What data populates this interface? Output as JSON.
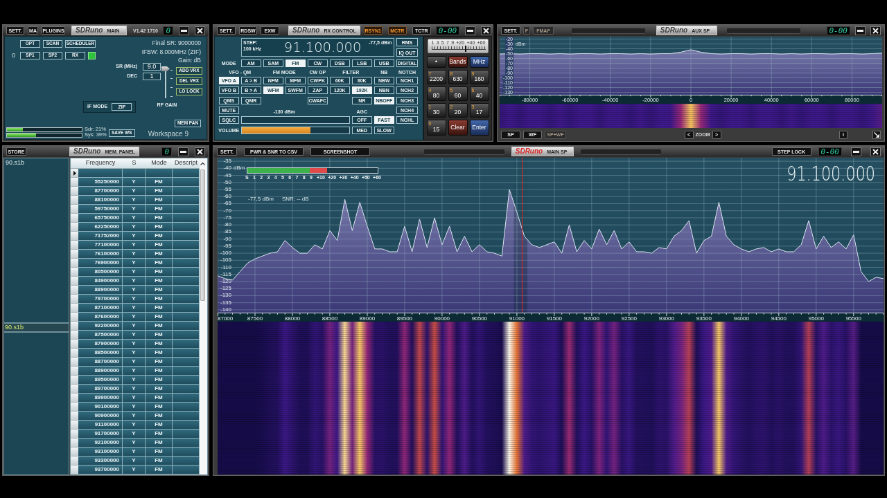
{
  "main_panel": {
    "title_bar": {
      "buttons": [
        "SETT.",
        "MA",
        "PLUGINS"
      ],
      "logo": "SDRuno",
      "title": "MAIN",
      "active": false,
      "version": "V1.42 1710",
      "counter": "0"
    },
    "top_buttons": [
      "OPT",
      "SCAN",
      "SCHEDULER"
    ],
    "rx_number": "0",
    "rx_buttons": [
      "SP1",
      "SP2",
      "RX"
    ],
    "rx_indicator": {
      "on": true
    },
    "info": [
      "Final SR: 9000000",
      "IFBW: 8.000MHz (ZIF)",
      "Gain: dB"
    ],
    "fields": [
      {
        "label": "SR (MHz)",
        "value": "9.0"
      },
      {
        "label": "DEC",
        "value": "1"
      }
    ],
    "rf_gain": {
      "label": "RF GAIN",
      "level": 1
    },
    "vrx_buttons": [
      "ADD VRX",
      "DEL VRX",
      "LO LOCK"
    ],
    "if_mode": {
      "label": "IF MODE",
      "value": "ZIF"
    },
    "mem_pan_button": "MEM PAN",
    "cpu_meters": [
      {
        "reading": "Sdr: 21%",
        "level": 0.21
      },
      {
        "reading": "Sys: 39%",
        "level": 0.39
      }
    ],
    "save_button": "SAVE WS",
    "workspace": "Workspace 9"
  },
  "rx_control": {
    "title_bar": {
      "left_buttons": [
        "SETT.",
        "RDSW",
        "EXW"
      ],
      "logo": "SDRuno",
      "title": "RX CONTROL",
      "active": false,
      "toggles": [
        {
          "label": "RSYN1",
          "on": true
        },
        {
          "label": "MCTR",
          "on": true
        },
        {
          "label": "TCTR",
          "on": false
        }
      ],
      "counter": "0-00"
    },
    "display": {
      "step_label": "STEP:",
      "step": "100 kHz",
      "frequency": "91.100.000",
      "signal": "-77,5 dBm"
    },
    "display_buttons": [
      "RMS",
      "IQ OUT"
    ],
    "mode": {
      "label": "MODE",
      "options": [
        {
          "label": "AM",
          "selected": false
        },
        {
          "label": "SAM",
          "selected": false
        },
        {
          "label": "FM",
          "selected": true
        },
        {
          "label": "CW",
          "selected": false
        },
        {
          "label": "DSB",
          "selected": false
        },
        {
          "label": "LSB",
          "selected": false
        },
        {
          "label": "USB",
          "selected": false
        },
        {
          "label": "DIGITAL",
          "selected": false
        }
      ]
    },
    "groups": [
      {
        "label": "VFO - QM",
        "buttons": [
          {
            "label": "VFO A",
            "selected": true
          },
          {
            "label": "A > B",
            "selected": false
          },
          {
            "label": "VFO B",
            "selected": false
          },
          {
            "label": "B > A",
            "selected": false
          },
          {
            "label": "QMS",
            "selected": false
          },
          {
            "label": "QMR",
            "selected": false
          }
        ]
      },
      {
        "label": "FM MODE",
        "buttons": [
          {
            "label": "NFM",
            "selected": false
          },
          {
            "label": "MFM",
            "selected": false
          },
          {
            "label": "WFM",
            "selected": true
          },
          {
            "label": "SWFM",
            "selected": false
          }
        ]
      },
      {
        "label": "CW OP",
        "buttons": [
          {
            "label": "CWPK",
            "selected": false
          },
          {
            "label": "ZAP",
            "selected": false
          },
          {
            "label": "CWAFC",
            "selected": false
          }
        ]
      },
      {
        "label": "FILTER",
        "buttons": [
          {
            "label": "60K",
            "selected": false
          },
          {
            "label": "80K",
            "selected": false
          },
          {
            "label": "120K",
            "selected": false
          },
          {
            "label": "192K",
            "selected": true
          },
          {
            "label": "NR",
            "selected": false
          }
        ]
      },
      {
        "label": "NB",
        "buttons": [
          {
            "label": "NBW",
            "selected": false
          },
          {
            "label": "NBN",
            "selected": false
          },
          {
            "label": "NBOFF",
            "selected": true
          }
        ]
      },
      {
        "label": "NOTCH",
        "buttons": [
          {
            "label": "NCH1",
            "selected": false
          },
          {
            "label": "NCH2",
            "selected": false
          },
          {
            "label": "NCH3",
            "selected": false
          },
          {
            "label": "NCH4",
            "selected": false
          },
          {
            "label": "NCHL",
            "selected": false
          }
        ]
      }
    ],
    "mute_button": "MUTE",
    "squelch_button": "SQLC",
    "squelch": {
      "reading": "-130 dBm"
    },
    "agc": {
      "label": "AGC",
      "options": [
        {
          "label": "OFF",
          "selected": false
        },
        {
          "label": "FAST",
          "selected": true
        },
        {
          "label": "MED",
          "selected": false
        },
        {
          "label": "SLOW",
          "selected": false
        }
      ]
    },
    "volume": {
      "label": "VOLUME",
      "level": 0.64
    },
    "keypad": {
      "meter": {
        "scale": [
          "1",
          "3",
          "5",
          "7",
          "9",
          "+20",
          "+40",
          "+60"
        ],
        "level": 0.62
      },
      "keys": [
        {
          "kind": "dark",
          "label": "•"
        },
        {
          "kind": "red",
          "label": "Bands"
        },
        {
          "kind": "blue",
          "label": "MHz"
        },
        {
          "kind": "dark",
          "digit": "7",
          "label": "2200"
        },
        {
          "kind": "dark",
          "digit": "8",
          "label": "630"
        },
        {
          "kind": "dark",
          "digit": "9",
          "label": "160"
        },
        {
          "kind": "dark",
          "digit": "4",
          "label": "80"
        },
        {
          "kind": "dark",
          "digit": "5",
          "label": "60"
        },
        {
          "kind": "dark",
          "digit": "6",
          "label": "40"
        },
        {
          "kind": "dark",
          "digit": "1",
          "label": "30"
        },
        {
          "kind": "dark",
          "digit": "2",
          "label": "20"
        },
        {
          "kind": "dark",
          "digit": "3",
          "label": "17"
        },
        {
          "kind": "dark",
          "digit": "0",
          "label": "15"
        },
        {
          "kind": "red",
          "label": "Clear"
        },
        {
          "kind": "blue",
          "label": "Enter"
        }
      ]
    }
  },
  "aux_spectrum": {
    "title_bar": {
      "left_buttons": [
        {
          "label": "SETT.",
          "disabled": false
        },
        {
          "label": "F",
          "disabled": true
        },
        {
          "label": "FMAF",
          "disabled": true
        }
      ],
      "logo": "SDRuno",
      "title": "AUX SP",
      "active": false,
      "counter": "0-00"
    },
    "chart_data": {
      "type": "area",
      "ylabel": "dBm",
      "x": [
        -95000,
        -90000,
        -85000,
        -80000,
        -75000,
        -70000,
        -65000,
        -60000,
        -55000,
        -50000,
        -45000,
        -40000,
        -35000,
        -30000,
        -25000,
        -20000,
        -15000,
        -10000,
        -5000,
        0,
        5000,
        10000,
        15000,
        20000,
        25000,
        30000,
        35000,
        40000,
        45000,
        50000,
        55000,
        60000,
        65000,
        70000,
        75000,
        80000,
        85000,
        90000,
        95000
      ],
      "series": [
        {
          "values": [
            -51,
            -50,
            -51,
            -50,
            -50,
            -51,
            -50,
            -51,
            -50,
            -50,
            -51,
            -50,
            -50,
            -51,
            -50,
            -51,
            -50,
            -50,
            -47,
            -42,
            -47,
            -50,
            -51,
            -50,
            -50,
            -51,
            -50,
            -50,
            -51,
            -50,
            -51,
            -50,
            -50,
            -51,
            -50,
            -50,
            -51,
            -50,
            -49
          ]
        }
      ],
      "xlim": [
        -95000,
        95000
      ],
      "ylim": [
        -135,
        -15
      ],
      "xticks": [
        -80000,
        -60000,
        -40000,
        -20000,
        0,
        20000,
        40000,
        60000,
        80000
      ],
      "yticks": [
        -20,
        -30,
        -40,
        -50,
        -60,
        -70,
        -80,
        -90,
        -100,
        -110,
        -120,
        -130
      ],
      "grid": true
    },
    "view_buttons": [
      {
        "label": "SP",
        "selected": false
      },
      {
        "label": "WF",
        "selected": false
      },
      {
        "label": "SP+WF",
        "selected": true
      }
    ],
    "zoom": {
      "label": "ZOOM",
      "previous": "<",
      "next": ">"
    },
    "info_button": "i"
  },
  "memory_panel": {
    "title_bar": {
      "buttons": [
        "STORE"
      ],
      "logo": "SDRuno",
      "title": "MEM. PANEL",
      "active": false,
      "counter": "0"
    },
    "bank_list": [
      {
        "name": "90.s1b",
        "selected": false
      }
    ],
    "file_field": {
      "value": "90.s1b"
    },
    "table": {
      "columns": [
        "Frequency",
        "S",
        "Mode",
        "Descript"
      ],
      "rows": [
        {
          "current": true
        },
        {
          "frequency": "55250000",
          "s": "Y",
          "mode": "FM",
          "current": false
        },
        {
          "frequency": "87700000",
          "s": "Y",
          "mode": "FM",
          "current": false
        },
        {
          "frequency": "88100000",
          "s": "Y",
          "mode": "FM",
          "current": false
        },
        {
          "frequency": "59750000",
          "s": "Y",
          "mode": "FM",
          "current": false
        },
        {
          "frequency": "65750000",
          "s": "Y",
          "mode": "FM",
          "current": false
        },
        {
          "frequency": "62250000",
          "s": "Y",
          "mode": "FM",
          "current": false
        },
        {
          "frequency": "71752000",
          "s": "Y",
          "mode": "FM",
          "current": false
        },
        {
          "frequency": "77100000",
          "s": "Y",
          "mode": "FM",
          "current": false
        },
        {
          "frequency": "76100000",
          "s": "Y",
          "mode": "FM",
          "current": false
        },
        {
          "frequency": "76900000",
          "s": "Y",
          "mode": "FM",
          "current": false
        },
        {
          "frequency": "80500000",
          "s": "Y",
          "mode": "FM",
          "current": false
        },
        {
          "frequency": "84900000",
          "s": "Y",
          "mode": "FM",
          "current": false
        },
        {
          "frequency": "88900000",
          "s": "Y",
          "mode": "FM",
          "current": false
        },
        {
          "frequency": "79700000",
          "s": "Y",
          "mode": "FM",
          "current": false
        },
        {
          "frequency": "87100000",
          "s": "Y",
          "mode": "FM",
          "current": false
        },
        {
          "frequency": "87600000",
          "s": "Y",
          "mode": "FM",
          "current": false
        },
        {
          "frequency": "92200000",
          "s": "Y",
          "mode": "FM",
          "current": false
        },
        {
          "frequency": "87500000",
          "s": "Y",
          "mode": "FM",
          "current": false
        },
        {
          "frequency": "87900000",
          "s": "Y",
          "mode": "FM",
          "current": false
        },
        {
          "frequency": "88500000",
          "s": "Y",
          "mode": "FM",
          "current": false
        },
        {
          "frequency": "88700000",
          "s": "Y",
          "mode": "FM",
          "current": false
        },
        {
          "frequency": "88900000",
          "s": "Y",
          "mode": "FM",
          "current": false
        },
        {
          "frequency": "89500000",
          "s": "Y",
          "mode": "FM",
          "current": false
        },
        {
          "frequency": "89700000",
          "s": "Y",
          "mode": "FM",
          "current": false
        },
        {
          "frequency": "89900000",
          "s": "Y",
          "mode": "FM",
          "current": false
        },
        {
          "frequency": "90100000",
          "s": "Y",
          "mode": "FM",
          "current": false
        },
        {
          "frequency": "90900000",
          "s": "Y",
          "mode": "FM",
          "current": false
        },
        {
          "frequency": "91100000",
          "s": "Y",
          "mode": "FM",
          "current": false
        },
        {
          "frequency": "91700000",
          "s": "Y",
          "mode": "FM",
          "current": false
        },
        {
          "frequency": "92100000",
          "s": "Y",
          "mode": "FM",
          "current": false
        },
        {
          "frequency": "93100000",
          "s": "Y",
          "mode": "FM",
          "current": false
        },
        {
          "frequency": "93300000",
          "s": "Y",
          "mode": "FM",
          "current": false
        },
        {
          "frequency": "93700000",
          "s": "Y",
          "mode": "FM",
          "current": false
        }
      ]
    }
  },
  "main_spectrum": {
    "title_bar": {
      "left_buttons": [
        "SETT.",
        "PWR & SNR TO CSV",
        "SCREENSHOT"
      ],
      "logo": "SDRuno",
      "title": "MAIN SP",
      "active": true,
      "right_button": "STEP LOCK",
      "counter": "0-00"
    },
    "s_meter": {
      "scale": [
        "S",
        "1",
        "2",
        "3",
        "4",
        "5",
        "6",
        "7",
        "8",
        "9",
        "+10",
        "+20",
        "+30",
        "+40",
        "+50",
        "+60"
      ],
      "level": 0.61
    },
    "readout": "-77,5 dBm",
    "snr": "SNR: -- dB",
    "frequency": "91.100.000",
    "chart_data": {
      "type": "area",
      "ylabel": "dBm",
      "x": [
        87000,
        87100,
        87200,
        87300,
        87400,
        87500,
        87600,
        87700,
        87800,
        87900,
        88000,
        88100,
        88200,
        88300,
        88400,
        88500,
        88600,
        88700,
        88800,
        88900,
        89000,
        89100,
        89200,
        89300,
        89400,
        89500,
        89600,
        89700,
        89800,
        89900,
        90000,
        90100,
        90200,
        90300,
        90400,
        90500,
        90600,
        90700,
        90800,
        90900,
        91000,
        91100,
        91200,
        91300,
        91400,
        91500,
        91600,
        91700,
        91800,
        91900,
        92000,
        92100,
        92200,
        92300,
        92400,
        92500,
        92600,
        92700,
        92800,
        92900,
        93000,
        93100,
        93200,
        93300,
        93400,
        93500,
        93600,
        93700,
        93800,
        93900,
        94000,
        94100,
        94200,
        94300,
        94400,
        94500,
        94600,
        94700,
        94800,
        94900,
        95000,
        95100,
        95200,
        95300,
        95400,
        95500,
        95600,
        95700,
        95800,
        95900
      ],
      "series": [
        {
          "values": [
            -116,
            -118,
            -119,
            -113,
            -107,
            -104,
            -102,
            -100,
            -99,
            -91,
            -96,
            -100,
            -100,
            -94,
            -97,
            -84,
            -91,
            -62,
            -84,
            -64,
            -81,
            -97,
            -97,
            -99,
            -99,
            -81,
            -99,
            -76,
            -96,
            -75,
            -94,
            -81,
            -99,
            -88,
            -99,
            -94,
            -99,
            -100,
            -102,
            -55,
            -71,
            -88,
            -94,
            -96,
            -94,
            -92,
            -100,
            -80,
            -99,
            -91,
            -97,
            -83,
            -94,
            -84,
            -97,
            -92,
            -99,
            -99,
            -100,
            -96,
            -97,
            -88,
            -84,
            -77,
            -100,
            -91,
            -88,
            -64,
            -88,
            -94,
            -97,
            -99,
            -97,
            -96,
            -99,
            -97,
            -99,
            -99,
            -94,
            -77,
            -97,
            -88,
            -96,
            -92,
            -97,
            -87,
            -113,
            -120,
            -117,
            -118
          ]
        }
      ],
      "xlim": [
        87000,
        95900
      ],
      "ylim": [
        -142,
        -32.5
      ],
      "xticks": [
        87000,
        87500,
        88000,
        88500,
        89000,
        89500,
        90000,
        90500,
        91000,
        91500,
        92000,
        92500,
        93000,
        93500,
        94000,
        94500,
        95000,
        95500
      ],
      "yticks": [
        -35,
        -40,
        -45,
        -50,
        -55,
        -60,
        -65,
        -70,
        -75,
        -80,
        -85,
        -90,
        -95,
        -100,
        -105,
        -110,
        -115,
        -120,
        -125,
        -130,
        -135,
        -140
      ],
      "grid": true,
      "ref_lines": [
        {
          "axis": "x",
          "value": 91070
        }
      ],
      "bands": [
        {
          "axis": "x",
          "from": 90960,
          "to": 91140
        }
      ]
    }
  }
}
